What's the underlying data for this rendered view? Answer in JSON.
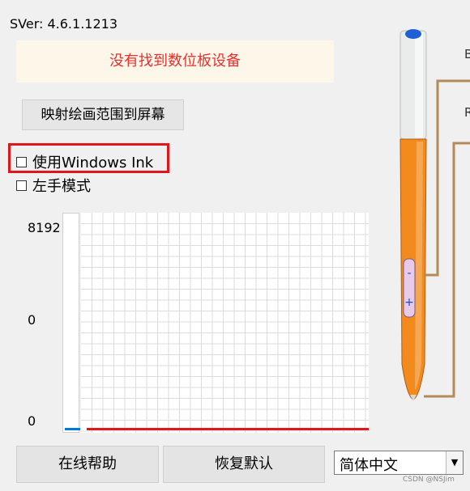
{
  "version": "SVer: 4.6.1.1213",
  "status": {
    "message": "没有找到数位板设备",
    "color": "#e83030"
  },
  "buttons": {
    "map_to_screen": "映射绘画范围到屏幕",
    "online_help": "在线帮助",
    "restore_defaults": "恢复默认"
  },
  "options": {
    "windows_ink": {
      "label": "使用Windows Ink",
      "checked": false,
      "highlighted": true
    },
    "left_hand": {
      "label": "左手模式",
      "checked": false
    }
  },
  "pressure_graph": {
    "y_labels": [
      "8192",
      "0",
      "0"
    ],
    "current_pressure_fraction": 0.01,
    "bar_color": "#0078d7",
    "line_color": "#e0161b"
  },
  "language": {
    "selected": "简体中文",
    "arrow_icon": "chevron-down-icon"
  },
  "pen": {
    "body_color": "#f28a1e",
    "side_buttons": [
      "-",
      "+"
    ],
    "callouts": [
      "B",
      "R"
    ]
  },
  "watermark": "CSDN @NSJim"
}
